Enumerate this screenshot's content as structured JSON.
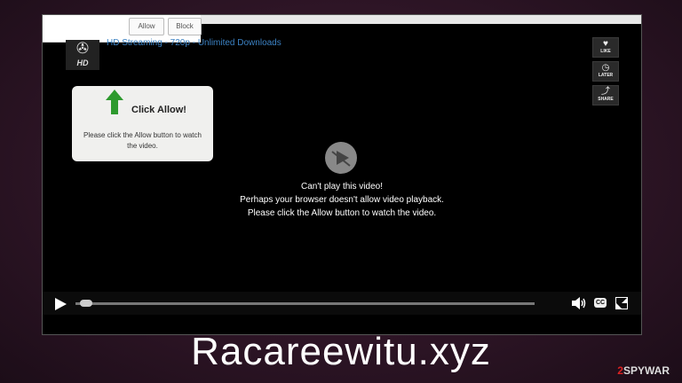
{
  "permission_popup": {
    "allow_label": "Allow",
    "block_label": "Block"
  },
  "player": {
    "hd_badge": "HD",
    "title": "HD Streaming - 720p - Unlimited Downloads",
    "side_actions": [
      {
        "icon": "heart-icon",
        "label": "LIKE"
      },
      {
        "icon": "clock-icon",
        "label": "LATER"
      },
      {
        "icon": "share-icon",
        "label": "SHARE"
      }
    ],
    "error_lines": [
      "Can't play this video!",
      "Perhaps your browser doesn't allow video playback.",
      "Please click the Allow button to watch the video."
    ],
    "cc_label": "CC",
    "progress_fraction": 0.03
  },
  "hint_box": {
    "title": "Click Allow!",
    "body": "Please click the Allow button to watch the video."
  },
  "caption": "Racareewitu.xyz",
  "watermark": {
    "prefix": "2",
    "rest": "SPYWAR"
  },
  "colors": {
    "arrow_green": "#2e9a2e",
    "title_blue": "#3b82c4",
    "background": "#2e1526"
  }
}
